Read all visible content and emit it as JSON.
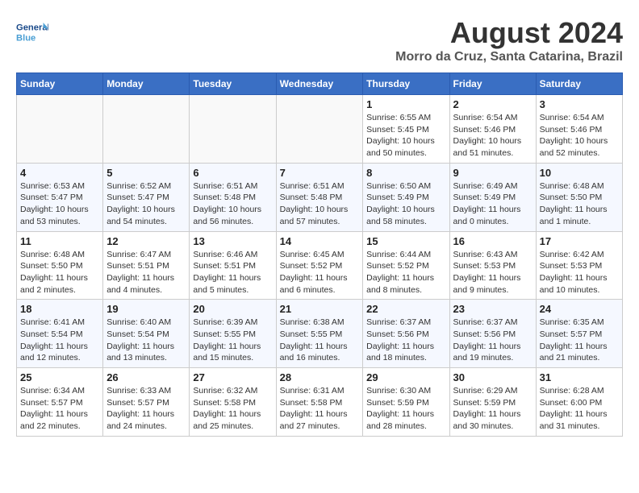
{
  "header": {
    "logo": {
      "general": "General",
      "blue": "Blue"
    },
    "title": "August 2024",
    "subtitle": "Morro da Cruz, Santa Catarina, Brazil"
  },
  "weekdays": [
    "Sunday",
    "Monday",
    "Tuesday",
    "Wednesday",
    "Thursday",
    "Friday",
    "Saturday"
  ],
  "weeks": [
    [
      {
        "day": "",
        "info": ""
      },
      {
        "day": "",
        "info": ""
      },
      {
        "day": "",
        "info": ""
      },
      {
        "day": "",
        "info": ""
      },
      {
        "day": "1",
        "info": "Sunrise: 6:55 AM\nSunset: 5:45 PM\nDaylight: 10 hours\nand 50 minutes."
      },
      {
        "day": "2",
        "info": "Sunrise: 6:54 AM\nSunset: 5:46 PM\nDaylight: 10 hours\nand 51 minutes."
      },
      {
        "day": "3",
        "info": "Sunrise: 6:54 AM\nSunset: 5:46 PM\nDaylight: 10 hours\nand 52 minutes."
      }
    ],
    [
      {
        "day": "4",
        "info": "Sunrise: 6:53 AM\nSunset: 5:47 PM\nDaylight: 10 hours\nand 53 minutes."
      },
      {
        "day": "5",
        "info": "Sunrise: 6:52 AM\nSunset: 5:47 PM\nDaylight: 10 hours\nand 54 minutes."
      },
      {
        "day": "6",
        "info": "Sunrise: 6:51 AM\nSunset: 5:48 PM\nDaylight: 10 hours\nand 56 minutes."
      },
      {
        "day": "7",
        "info": "Sunrise: 6:51 AM\nSunset: 5:48 PM\nDaylight: 10 hours\nand 57 minutes."
      },
      {
        "day": "8",
        "info": "Sunrise: 6:50 AM\nSunset: 5:49 PM\nDaylight: 10 hours\nand 58 minutes."
      },
      {
        "day": "9",
        "info": "Sunrise: 6:49 AM\nSunset: 5:49 PM\nDaylight: 11 hours\nand 0 minutes."
      },
      {
        "day": "10",
        "info": "Sunrise: 6:48 AM\nSunset: 5:50 PM\nDaylight: 11 hours\nand 1 minute."
      }
    ],
    [
      {
        "day": "11",
        "info": "Sunrise: 6:48 AM\nSunset: 5:50 PM\nDaylight: 11 hours\nand 2 minutes."
      },
      {
        "day": "12",
        "info": "Sunrise: 6:47 AM\nSunset: 5:51 PM\nDaylight: 11 hours\nand 4 minutes."
      },
      {
        "day": "13",
        "info": "Sunrise: 6:46 AM\nSunset: 5:51 PM\nDaylight: 11 hours\nand 5 minutes."
      },
      {
        "day": "14",
        "info": "Sunrise: 6:45 AM\nSunset: 5:52 PM\nDaylight: 11 hours\nand 6 minutes."
      },
      {
        "day": "15",
        "info": "Sunrise: 6:44 AM\nSunset: 5:52 PM\nDaylight: 11 hours\nand 8 minutes."
      },
      {
        "day": "16",
        "info": "Sunrise: 6:43 AM\nSunset: 5:53 PM\nDaylight: 11 hours\nand 9 minutes."
      },
      {
        "day": "17",
        "info": "Sunrise: 6:42 AM\nSunset: 5:53 PM\nDaylight: 11 hours\nand 10 minutes."
      }
    ],
    [
      {
        "day": "18",
        "info": "Sunrise: 6:41 AM\nSunset: 5:54 PM\nDaylight: 11 hours\nand 12 minutes."
      },
      {
        "day": "19",
        "info": "Sunrise: 6:40 AM\nSunset: 5:54 PM\nDaylight: 11 hours\nand 13 minutes."
      },
      {
        "day": "20",
        "info": "Sunrise: 6:39 AM\nSunset: 5:55 PM\nDaylight: 11 hours\nand 15 minutes."
      },
      {
        "day": "21",
        "info": "Sunrise: 6:38 AM\nSunset: 5:55 PM\nDaylight: 11 hours\nand 16 minutes."
      },
      {
        "day": "22",
        "info": "Sunrise: 6:37 AM\nSunset: 5:56 PM\nDaylight: 11 hours\nand 18 minutes."
      },
      {
        "day": "23",
        "info": "Sunrise: 6:37 AM\nSunset: 5:56 PM\nDaylight: 11 hours\nand 19 minutes."
      },
      {
        "day": "24",
        "info": "Sunrise: 6:35 AM\nSunset: 5:57 PM\nDaylight: 11 hours\nand 21 minutes."
      }
    ],
    [
      {
        "day": "25",
        "info": "Sunrise: 6:34 AM\nSunset: 5:57 PM\nDaylight: 11 hours\nand 22 minutes."
      },
      {
        "day": "26",
        "info": "Sunrise: 6:33 AM\nSunset: 5:57 PM\nDaylight: 11 hours\nand 24 minutes."
      },
      {
        "day": "27",
        "info": "Sunrise: 6:32 AM\nSunset: 5:58 PM\nDaylight: 11 hours\nand 25 minutes."
      },
      {
        "day": "28",
        "info": "Sunrise: 6:31 AM\nSunset: 5:58 PM\nDaylight: 11 hours\nand 27 minutes."
      },
      {
        "day": "29",
        "info": "Sunrise: 6:30 AM\nSunset: 5:59 PM\nDaylight: 11 hours\nand 28 minutes."
      },
      {
        "day": "30",
        "info": "Sunrise: 6:29 AM\nSunset: 5:59 PM\nDaylight: 11 hours\nand 30 minutes."
      },
      {
        "day": "31",
        "info": "Sunrise: 6:28 AM\nSunset: 6:00 PM\nDaylight: 11 hours\nand 31 minutes."
      }
    ]
  ]
}
